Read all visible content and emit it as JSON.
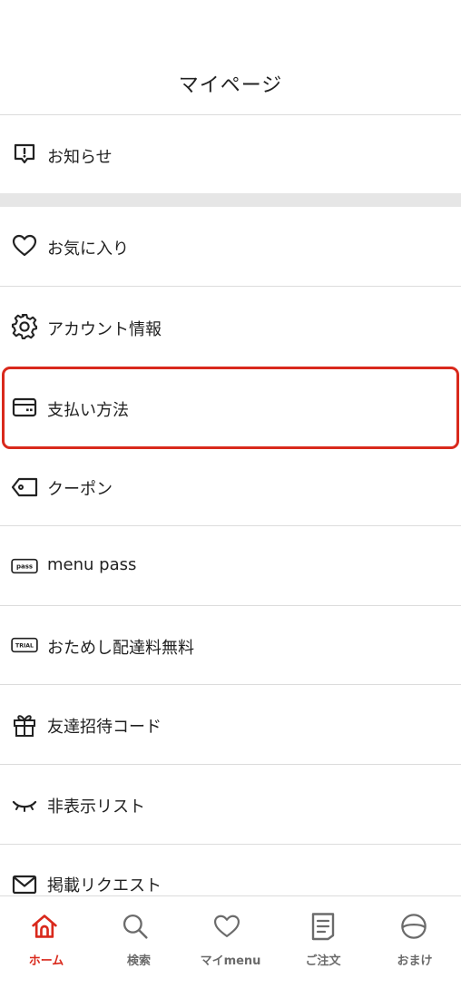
{
  "header": {
    "title": "マイページ"
  },
  "menu": {
    "notifications": {
      "label": "お知らせ",
      "icon": "notification-icon"
    },
    "favorites": {
      "label": "お気に入り",
      "icon": "heart-icon"
    },
    "account": {
      "label": "アカウント情報",
      "icon": "gear-icon"
    },
    "payment": {
      "label": "支払い方法",
      "icon": "credit-card-icon"
    },
    "coupon": {
      "label": "クーポン",
      "icon": "coupon-tag-icon"
    },
    "menu_pass": {
      "label": "menu pass",
      "icon": "pass-badge-icon",
      "badge_text": "pass"
    },
    "trial": {
      "label": "おためし配達料無料",
      "icon": "trial-badge-icon",
      "badge_text": "TRIAL"
    },
    "invite": {
      "label": "友達招待コード",
      "icon": "gift-icon"
    },
    "hidden_list": {
      "label": "非表示リスト",
      "icon": "closed-eye-icon"
    },
    "listing_request": {
      "label": "掲載リクエスト",
      "icon": "mail-icon"
    }
  },
  "tabbar": {
    "home": {
      "label": "ホーム",
      "icon": "home-icon",
      "active": true
    },
    "search": {
      "label": "検索",
      "icon": "search-icon"
    },
    "my_menu": {
      "label": "マイmenu",
      "icon": "heart-icon"
    },
    "orders": {
      "label": "ご注文",
      "icon": "document-icon"
    },
    "extras": {
      "label": "おまけ",
      "icon": "bowl-icon"
    }
  },
  "colors": {
    "accent": "#d9291c",
    "text": "#222222",
    "tab_inactive": "#6b6b6b",
    "divider": "#dcdcdc",
    "section_gap": "#e6e6e6"
  }
}
